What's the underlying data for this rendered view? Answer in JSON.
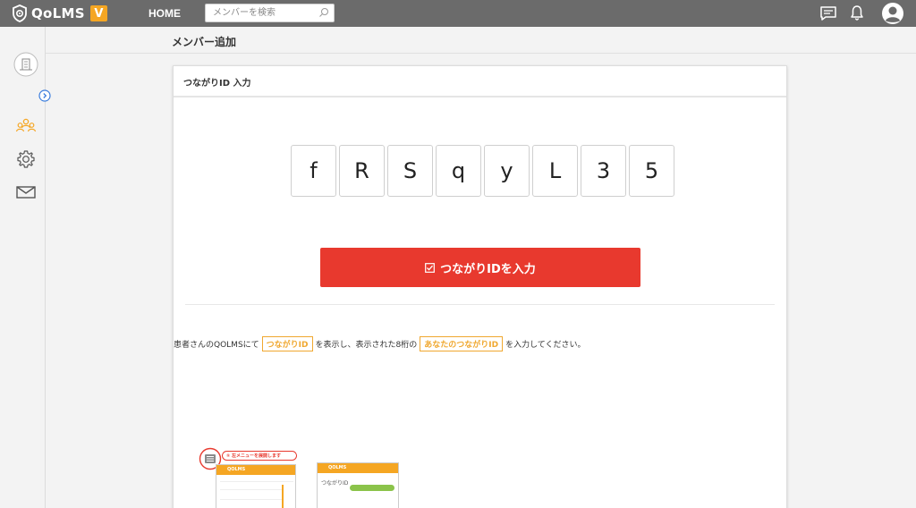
{
  "app": {
    "logo_text": "QoLMS",
    "logo_badge": "V",
    "home_label": "HOME",
    "search_placeholder": "メンバーを検索"
  },
  "page": {
    "title": "メンバー追加"
  },
  "panel": {
    "title": "つながりID 入力",
    "code_chars": [
      "f",
      "R",
      "S",
      "q",
      "y",
      "L",
      "3",
      "5"
    ],
    "submit_label": "つながりIDを入力",
    "instruction": {
      "part1": "患者さんのQOLMSにて",
      "highlight1": "つながりID",
      "part2": "を表示し、表示された8桁の",
      "highlight2": "あなたのつながりID",
      "part3": "を入力してください。"
    }
  },
  "illustration": {
    "step1_caption": "① 左メニューを展開します",
    "phone1_title": "QOLMS",
    "phone2_title": "QOLMS",
    "phone2_item": "つながりID"
  },
  "colors": {
    "topbar": "#6b6b6b",
    "accent_orange": "#f5a623",
    "button_red": "#e8392e",
    "highlight_orange": "#f0a830",
    "sidebar_active": "#f5a623",
    "link_blue": "#3b7ddd"
  }
}
